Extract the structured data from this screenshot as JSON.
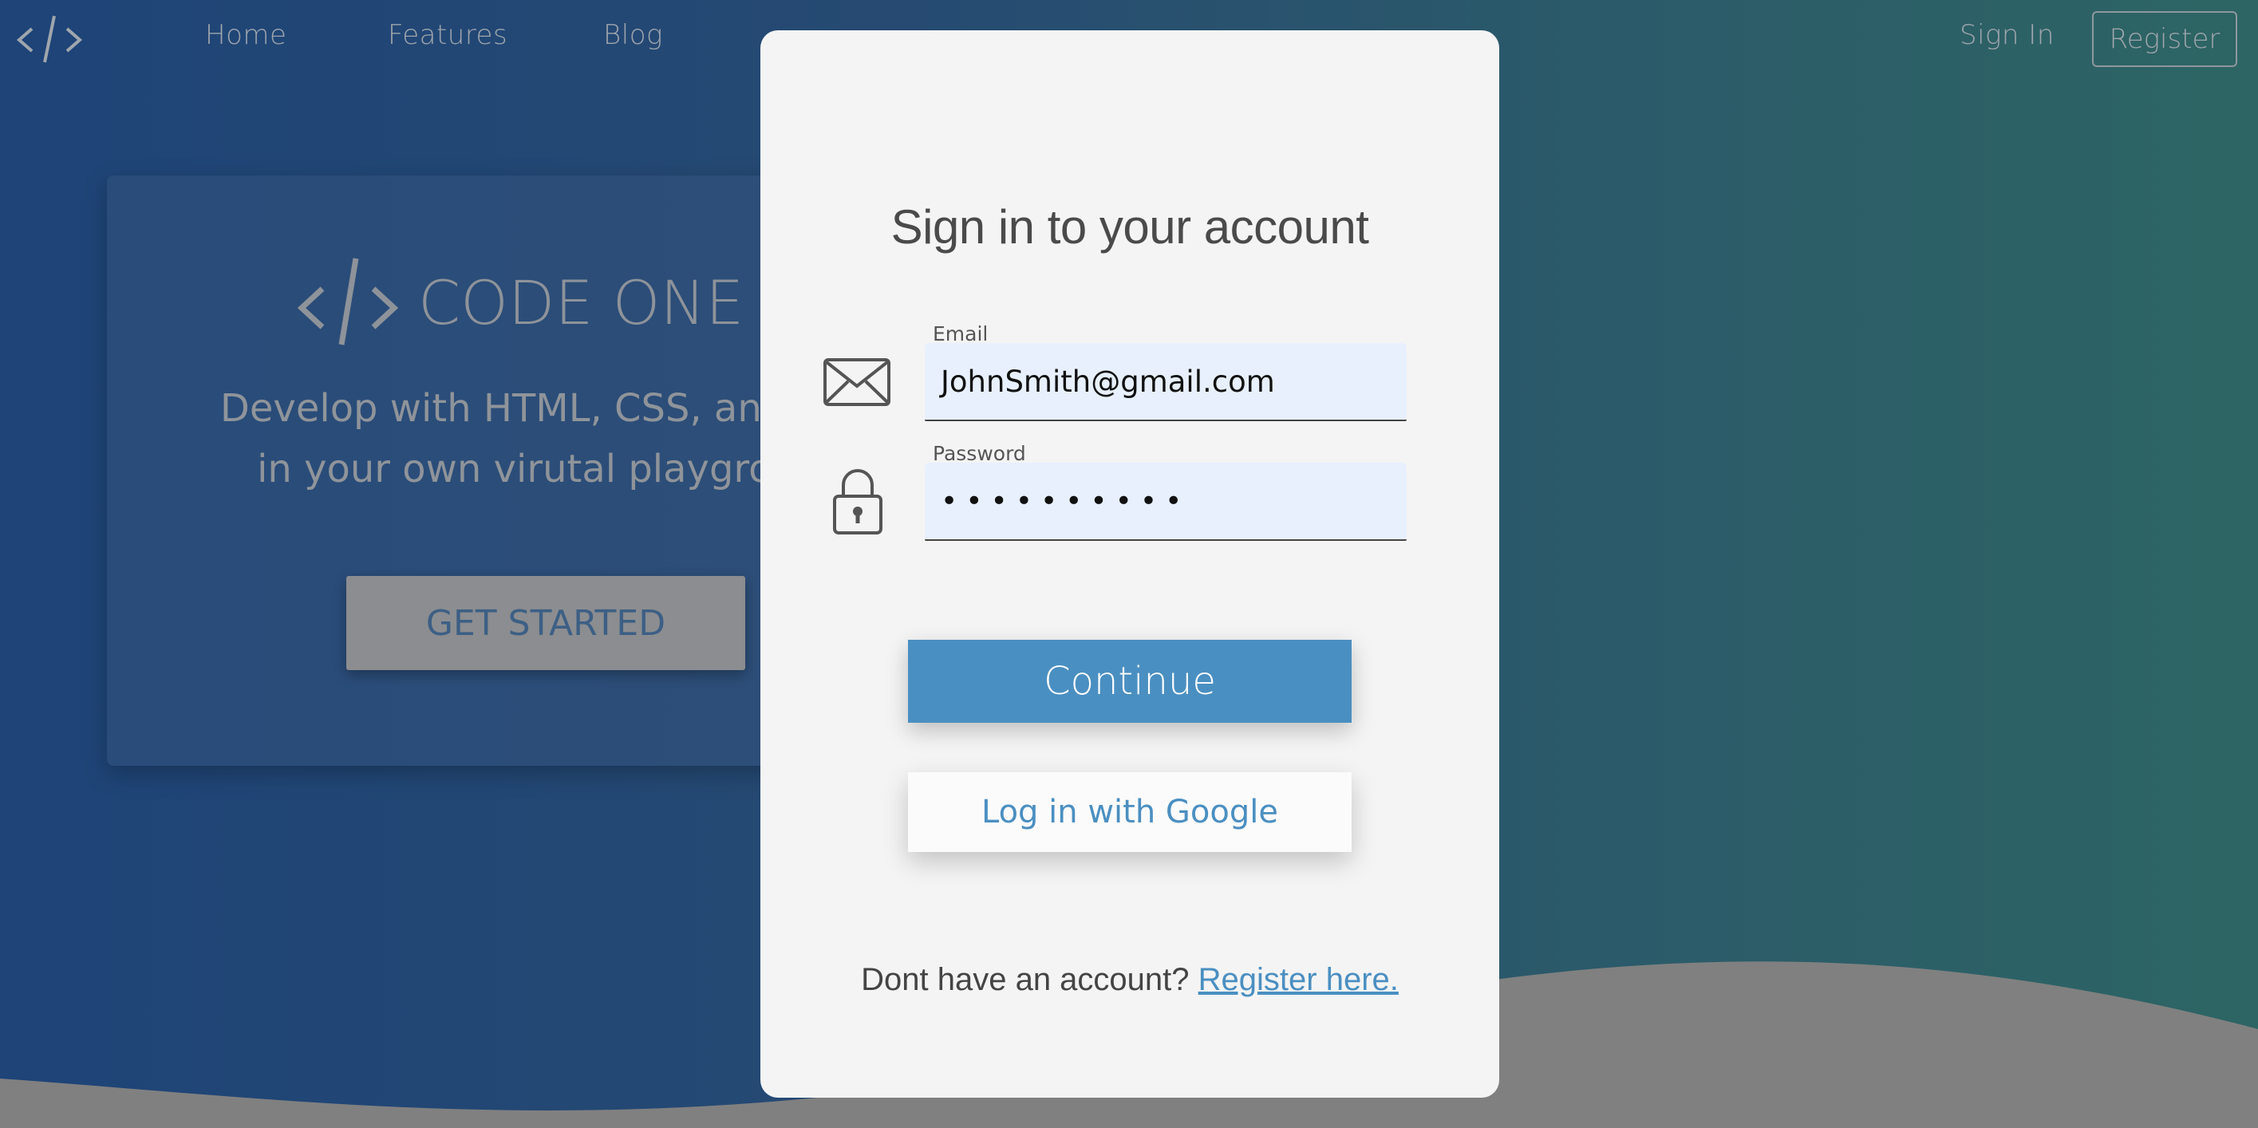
{
  "nav": {
    "logo_icon": "code-brackets-icon",
    "links": [
      "Home",
      "Features",
      "Blog"
    ],
    "sign_in": "Sign In",
    "register": "Register"
  },
  "hero": {
    "brand": "CODE ONE",
    "subtitle_line1": "Develop with HTML, CSS, and Ja",
    "subtitle_line2": "in your own virutal playgrou",
    "cta": "GET STARTED"
  },
  "modal": {
    "title": "Sign in to your account",
    "email": {
      "label": "Email",
      "value": "JohnSmith@gmail.com",
      "icon": "envelope-icon"
    },
    "password": {
      "label": "Password",
      "value": "••••••••••",
      "icon": "lock-icon"
    },
    "continue_label": "Continue",
    "google_label": "Log in with Google",
    "footer_prompt": "Dont have an account?",
    "footer_link": "Register here."
  },
  "colors": {
    "accent": "#4a8fc1",
    "modal_bg": "#f4f4f4",
    "field_bg": "#e8f0fe",
    "wave": "#808080"
  }
}
